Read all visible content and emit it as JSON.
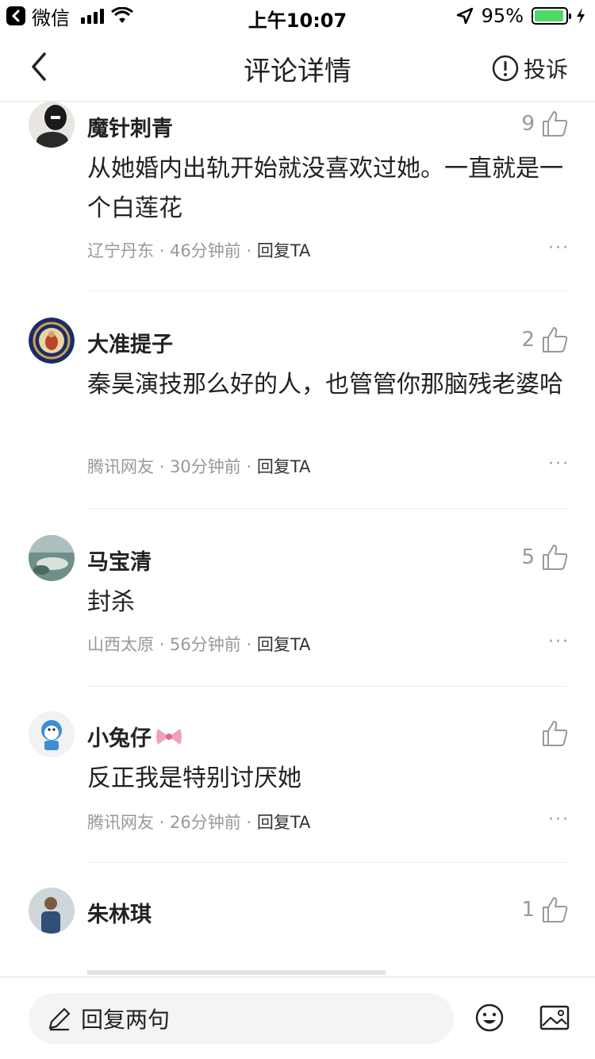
{
  "status_bar": {
    "back_app_label": "微信",
    "time": "上午10:07",
    "battery_percent": "95%",
    "battery_level": 0.95
  },
  "nav": {
    "title": "评论详情",
    "report_label": "投诉"
  },
  "comments": [
    {
      "username": "魔针刺青",
      "likes": "9",
      "text": "从她婚内出轨开始就没喜欢过她。一直就是一个白莲花",
      "location": "辽宁丹东",
      "time": "46分钟前",
      "reply_label": "回复TA",
      "more": "···"
    },
    {
      "username": "大准提子",
      "likes": "2",
      "text": "秦昊演技那么好的人，也管管你那脑残老婆哈",
      "location": "腾讯网友",
      "time": "30分钟前",
      "reply_label": "回复TA",
      "more": "···"
    },
    {
      "username": "马宝清",
      "likes": "5",
      "text": "封杀",
      "location": "山西太原",
      "time": "56分钟前",
      "reply_label": "回复TA",
      "more": "···"
    },
    {
      "username": "小兔仔",
      "likes": "",
      "text": "反正我是特别讨厌她",
      "location": "腾讯网友",
      "time": "26分钟前",
      "reply_label": "回复TA",
      "more": "···"
    },
    {
      "username": "朱林琪",
      "likes": "1"
    }
  ],
  "bottom_bar": {
    "reply_placeholder": "回复两句"
  },
  "colors": {
    "battery_green": "#4cd964",
    "meta_gray": "#999999",
    "text_dark": "#222222"
  }
}
